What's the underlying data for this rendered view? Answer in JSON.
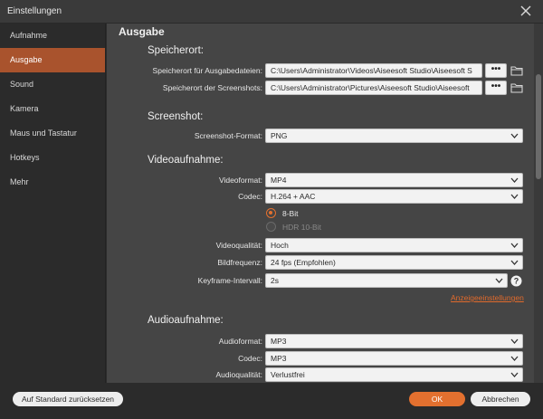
{
  "window": {
    "title": "Einstellungen"
  },
  "sidebar": {
    "items": [
      {
        "label": "Aufnahme"
      },
      {
        "label": "Ausgabe"
      },
      {
        "label": "Sound"
      },
      {
        "label": "Kamera"
      },
      {
        "label": "Maus und Tastatur"
      },
      {
        "label": "Hotkeys"
      },
      {
        "label": "Mehr"
      }
    ],
    "active": "Ausgabe"
  },
  "main": {
    "section_title": "Ausgabe",
    "speicherort": {
      "title": "Speicherort:",
      "output_label": "Speicherort für Ausgabedateien:",
      "output_value": "C:\\Users\\Administrator\\Videos\\Aiseesoft Studio\\Aiseesoft S",
      "screenshots_label": "Speicherort der Screenshots:",
      "screenshots_value": "C:\\Users\\Administrator\\Pictures\\Aiseesoft Studio\\Aiseesoft",
      "browse_label": "•••"
    },
    "screenshot": {
      "title": "Screenshot:",
      "format_label": "Screenshot-Format:",
      "format_value": "PNG"
    },
    "video": {
      "title": "Videoaufnahme:",
      "format_label": "Videoformat:",
      "format_value": "MP4",
      "codec_label": "Codec:",
      "codec_value": "H.264 + AAC",
      "bit_options": [
        {
          "label": "8-Bit",
          "selected": true
        },
        {
          "label": "HDR 10-Bit",
          "selected": false
        }
      ],
      "quality_label": "Videoqualität:",
      "quality_value": "Hoch",
      "framerate_label": "Bildfrequenz:",
      "framerate_value": "24 fps (Empfohlen)",
      "keyframe_label": "Keyframe-Intervall:",
      "keyframe_value": "2s",
      "display_settings_link": "Anzeigeeinstellungen"
    },
    "audio": {
      "title": "Audioaufnahme:",
      "format_label": "Audioformat:",
      "format_value": "MP3",
      "codec_label": "Codec:",
      "codec_value": "MP3",
      "quality_label": "Audioqualität:",
      "quality_value": "Verlustfrei"
    }
  },
  "footer": {
    "reset_label": "Auf Standard zurücksetzen",
    "ok_label": "OK",
    "cancel_label": "Abbrechen"
  },
  "colors": {
    "accent": "#e3702f",
    "sidebar_active": "#a9532d",
    "content_bg": "#454545",
    "sidebar_bg": "#2b2b2b"
  }
}
